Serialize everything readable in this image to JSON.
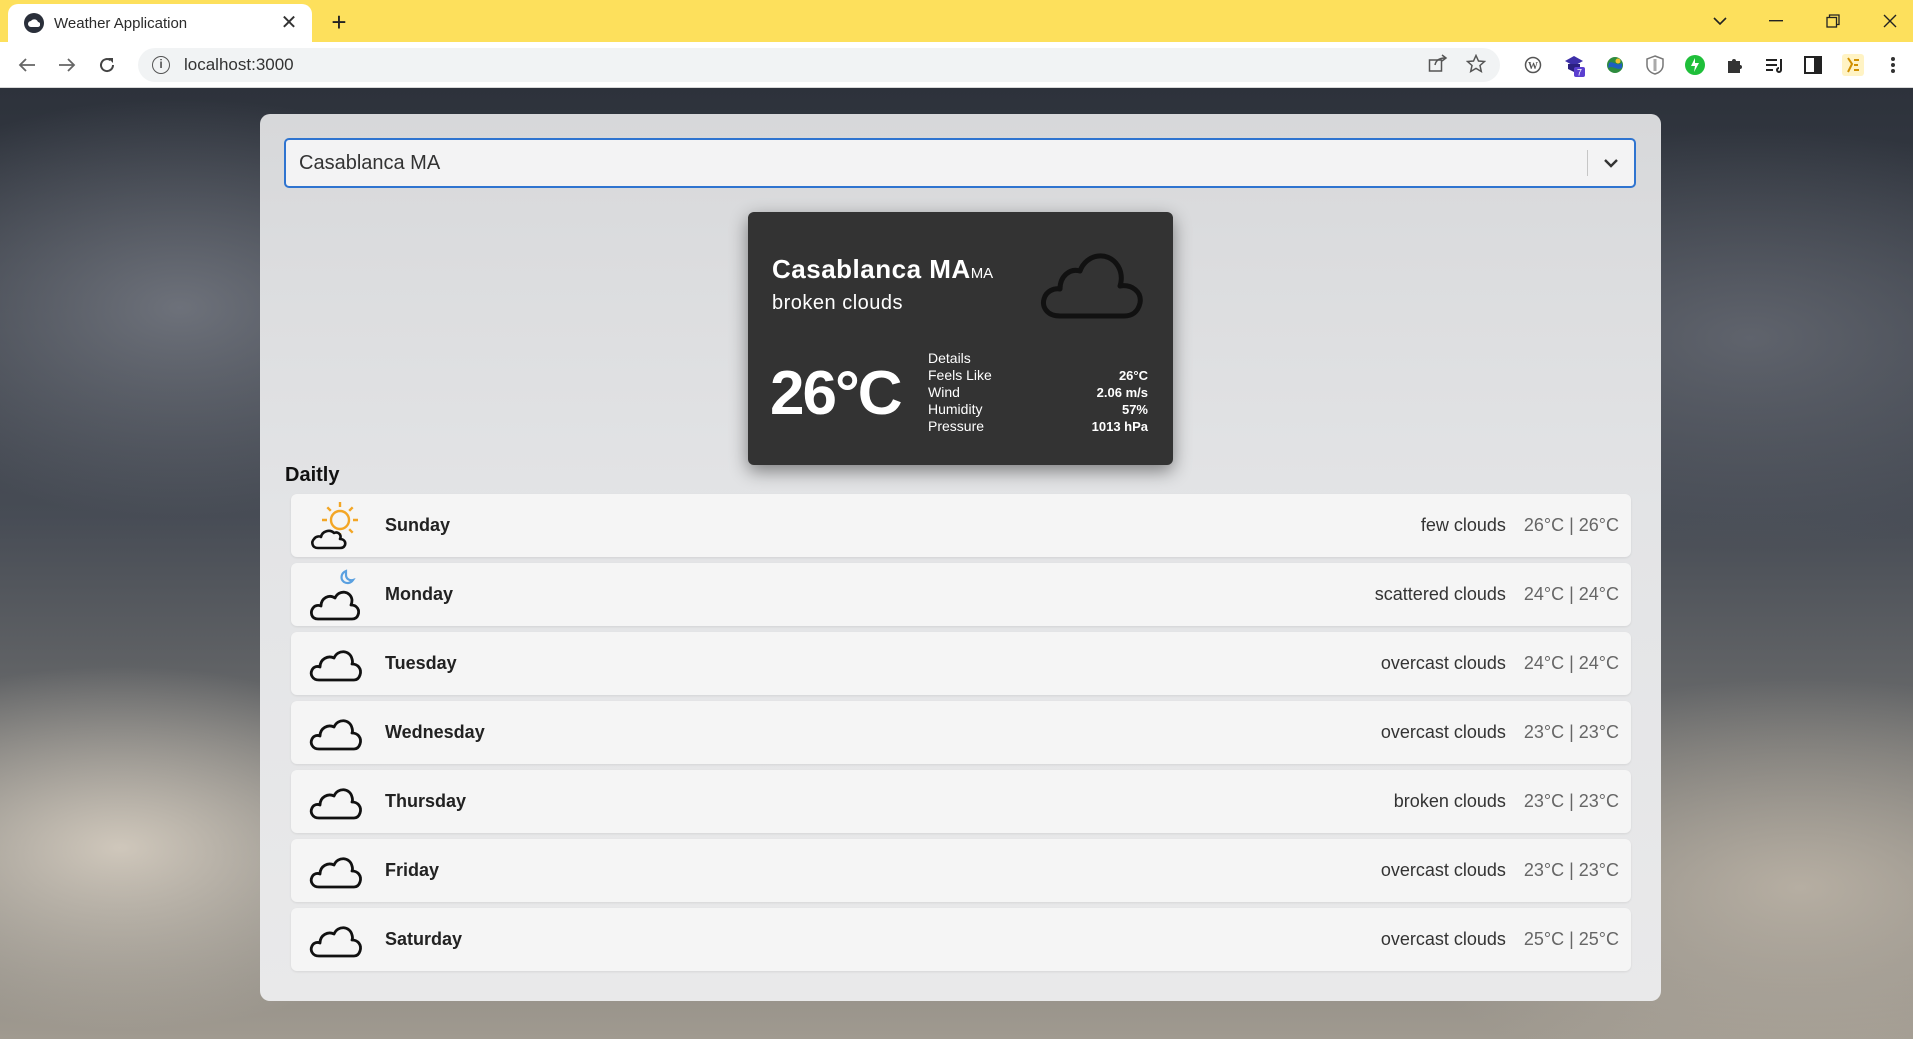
{
  "browser": {
    "tab_title": "Weather Application",
    "new_tab": "+",
    "url": "localhost:3000",
    "extension_badge": "7"
  },
  "app": {
    "city_select_value": "Casablanca MA",
    "current": {
      "city": "Casablanca MA",
      "country": "MA",
      "description": "broken clouds",
      "temperature": "26°C",
      "icon": "cloud-icon",
      "details_title": "Details",
      "details": [
        {
          "label": "Feels Like",
          "value": "26°C"
        },
        {
          "label": "Wind",
          "value": "2.06 m/s"
        },
        {
          "label": "Humidity",
          "value": "57%"
        },
        {
          "label": "Pressure",
          "value": "1013 hPa"
        }
      ]
    },
    "daily_title": "Daitly",
    "daily": [
      {
        "day": "Sunday",
        "description": "few clouds",
        "temps": "26°C | 26°C",
        "icon": "sun-cloud-icon"
      },
      {
        "day": "Monday",
        "description": "scattered clouds",
        "temps": "24°C | 24°C",
        "icon": "moon-cloud-icon"
      },
      {
        "day": "Tuesday",
        "description": "overcast clouds",
        "temps": "24°C | 24°C",
        "icon": "cloud-icon"
      },
      {
        "day": "Wednesday",
        "description": "overcast clouds",
        "temps": "23°C | 23°C",
        "icon": "cloud-icon"
      },
      {
        "day": "Thursday",
        "description": "broken clouds",
        "temps": "23°C | 23°C",
        "icon": "cloud-icon"
      },
      {
        "day": "Friday",
        "description": "overcast clouds",
        "temps": "23°C | 23°C",
        "icon": "cloud-icon"
      },
      {
        "day": "Saturday",
        "description": "overcast clouds",
        "temps": "25°C | 25°C",
        "icon": "cloud-icon"
      }
    ]
  },
  "colors": {
    "tabstrip": "#fde05c",
    "select_border": "#2f74d0",
    "card_background": "#333333",
    "sun": "#f3a625",
    "moon": "#5aa0e0"
  }
}
